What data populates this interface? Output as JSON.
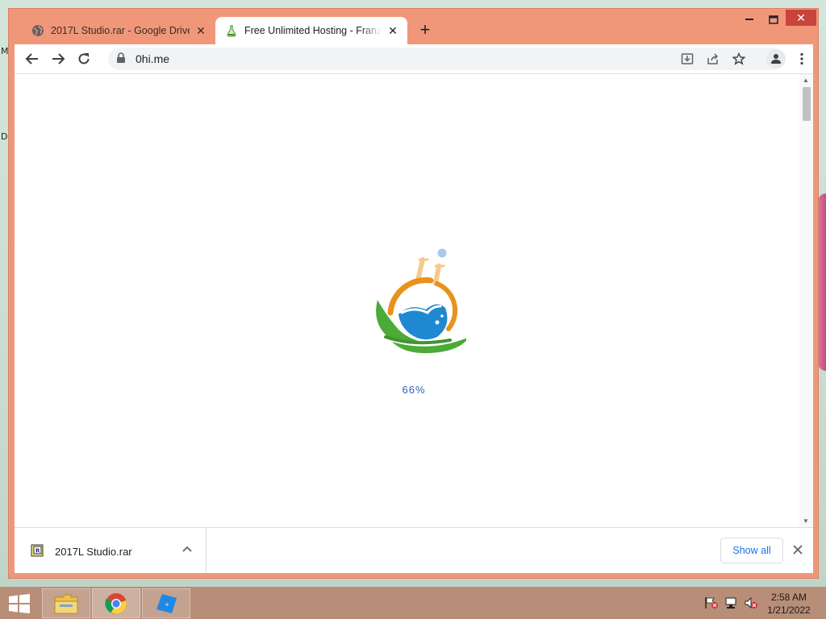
{
  "browser": {
    "tabs": [
      {
        "title": "2017L Studio.rar - Google Drive",
        "icon": "globe-icon",
        "active": false
      },
      {
        "title": "Free Unlimited Hosting - FranzLe",
        "icon": "flask-icon",
        "active": true
      }
    ],
    "new_tab_label": "+",
    "url": "0hi.me"
  },
  "page": {
    "loading_percent": "66%",
    "progress": 0.66
  },
  "download_shelf": {
    "file_name": "2017L Studio.rar",
    "show_all_label": "Show all"
  },
  "taskbar": {
    "time": "2:58 AM",
    "date": "1/21/2022"
  },
  "desktop": {
    "edge_labels": [
      "M",
      "D"
    ]
  },
  "colors": {
    "window_frame": "#f0977a",
    "accent_blue": "#1a73e8",
    "taskbar": "#b88e78",
    "close_button": "#c9443a"
  }
}
